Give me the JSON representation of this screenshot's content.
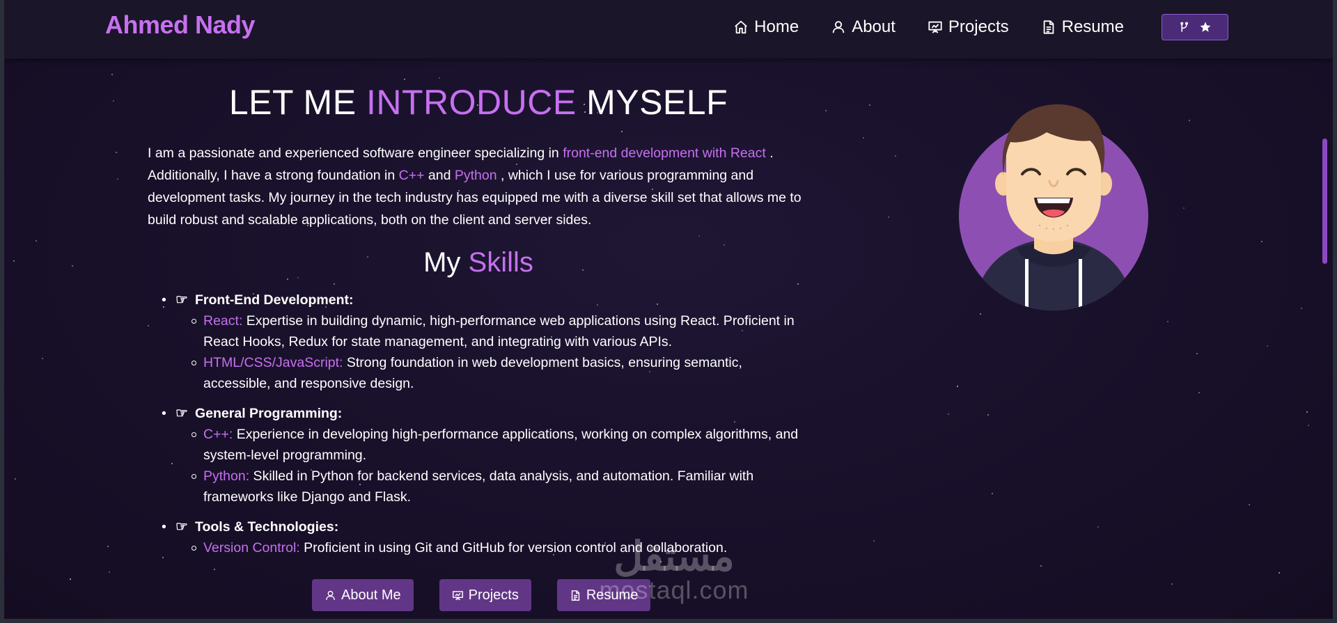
{
  "brand": "Ahmed Nady",
  "nav": {
    "home": "Home",
    "about": "About",
    "projects": "Projects",
    "resume": "Resume"
  },
  "heading": {
    "part1": "LET ME ",
    "highlight": "INTRODUCE",
    "part2": " MYSELF"
  },
  "intro": {
    "t1": "I am a passionate and experienced software engineer specializing in ",
    "h1": "front-end development with React",
    "t2": " . Additionally, I have a strong foundation in ",
    "h2": "C++",
    "t3": " and ",
    "h3": "Python",
    "t4": " , which I use for various programming and development tasks. My journey in the tech industry has equipped me with a diverse skill set that allows me to build robust and scalable applications, both on the client and server sides."
  },
  "skills_title": {
    "part1": "My ",
    "highlight": "Skills"
  },
  "skills": [
    {
      "title": "Front-End Development:",
      "items": [
        {
          "label": "React:",
          "text": " Expertise in building dynamic, high-performance web applications using React. Proficient in React Hooks, Redux for state management, and integrating with various APIs."
        },
        {
          "label": "HTML/CSS/JavaScript:",
          "text": " Strong foundation in web development basics, ensuring semantic, accessible, and responsive design."
        }
      ]
    },
    {
      "title": "General Programming:",
      "items": [
        {
          "label": "C++:",
          "text": " Experience in developing high-performance applications, working on complex algorithms, and system-level programming."
        },
        {
          "label": "Python:",
          "text": " Skilled in Python for backend services, data analysis, and automation. Familiar with frameworks like Django and Flask."
        }
      ]
    },
    {
      "title": "Tools & Technologies:",
      "items": [
        {
          "label": "Version Control:",
          "text": " Proficient in using Git and GitHub for version control and collaboration."
        }
      ]
    }
  ],
  "buttons": {
    "about": "About Me",
    "projects": "Projects",
    "resume": "Resume"
  },
  "watermark": {
    "arabic": "مستقل",
    "latin": "mostaql.com"
  },
  "colors": {
    "accent": "#c770f0",
    "button": "#623686",
    "background": "#1c1530"
  }
}
